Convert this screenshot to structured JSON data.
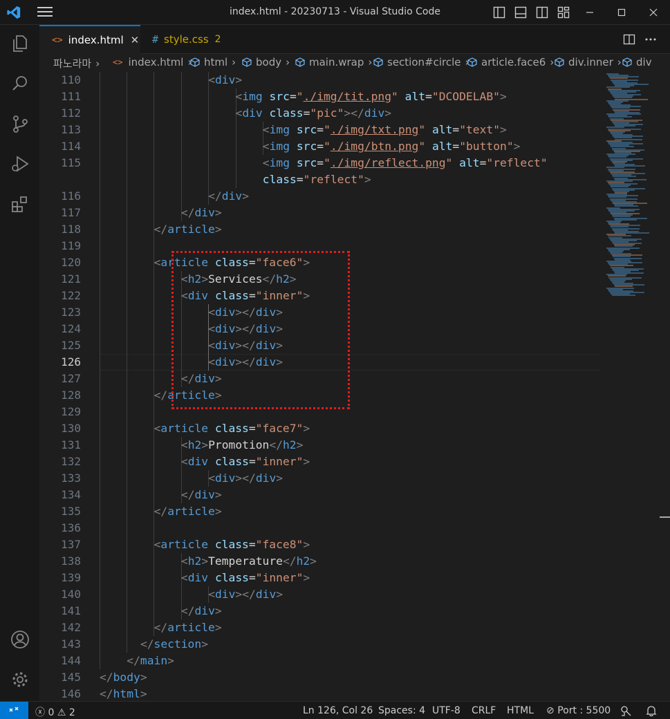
{
  "window": {
    "title": "index.html - 20230713 - Visual Studio Code"
  },
  "tabs": [
    {
      "label": "index.html",
      "icon": "<>",
      "active": true
    },
    {
      "label": "style.css",
      "icon": "#",
      "badge": "2",
      "active": false
    }
  ],
  "breadcrumb": [
    "파노라마",
    "index.html",
    "html",
    "body",
    "main.wrap",
    "section#circle",
    "article.face6",
    "div.inner",
    "div"
  ],
  "editor": {
    "line_numbers": [
      "110",
      "111",
      "112",
      "113",
      "114",
      "115",
      "",
      "116",
      "117",
      "118",
      "119",
      "120",
      "121",
      "122",
      "123",
      "124",
      "125",
      "126",
      "127",
      "128",
      "129",
      "130",
      "131",
      "132",
      "133",
      "134",
      "135",
      "136",
      "137",
      "138",
      "139",
      "140",
      "141",
      "142",
      "143",
      "144",
      "145",
      "146"
    ],
    "current_line": "126"
  },
  "status": {
    "errors": "0",
    "warnings": "2",
    "position": "Ln 126, Col 26",
    "spaces": "Spaces: 4",
    "encoding": "UTF-8",
    "eol": "CRLF",
    "language": "HTML",
    "port": "Port : 5500"
  },
  "colors": {
    "accent": "#0078d4",
    "tag": "#569cd6",
    "attribute": "#9cdcfe",
    "string": "#ce9178",
    "highlight_box": "#e01e1e"
  },
  "icons": {
    "activity": [
      "explorer-icon",
      "search-icon",
      "source-control-icon",
      "run-debug-icon",
      "extensions-icon",
      "account-icon",
      "settings-gear-icon"
    ]
  }
}
